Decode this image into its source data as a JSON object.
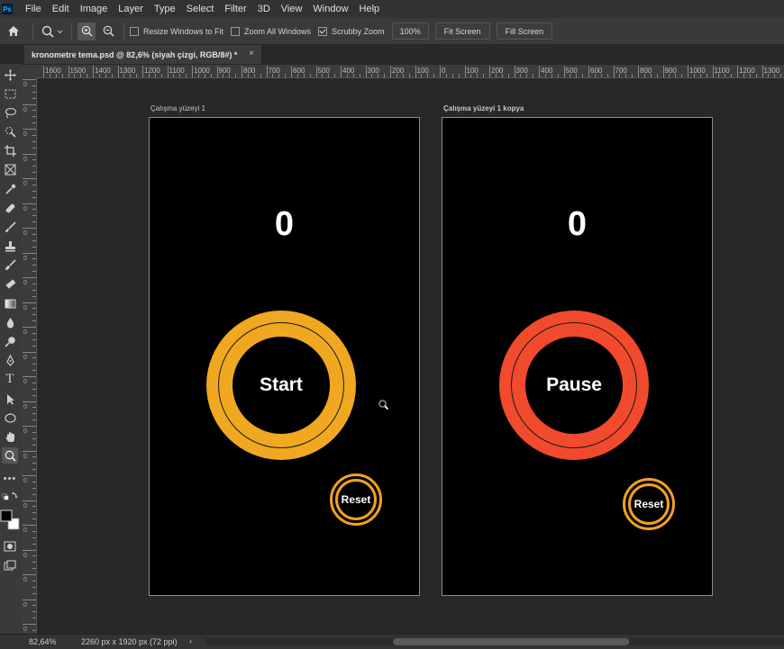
{
  "app": {
    "logo": "Ps"
  },
  "menu": [
    "File",
    "Edit",
    "Image",
    "Layer",
    "Type",
    "Select",
    "Filter",
    "3D",
    "View",
    "Window",
    "Help"
  ],
  "options_bar": {
    "resize_windows": "Resize Windows to Fit",
    "zoom_all": "Zoom All Windows",
    "scrubby_zoom": "Scrubby Zoom",
    "zoom_value": "100%",
    "fit_screen": "Fit Screen",
    "fill_screen": "Fill Screen"
  },
  "document_tab": {
    "title": "kronometre tema.psd @ 82,6% (siyah çizgi, RGB/8#) *",
    "close": "×"
  },
  "ruler_top": [
    "1600",
    "1500",
    "1400",
    "1300",
    "1200",
    "1100",
    "1000",
    "900",
    "800",
    "700",
    "600",
    "500",
    "400",
    "300",
    "200",
    "100",
    "0",
    "100",
    "200",
    "300",
    "400",
    "500",
    "600",
    "700",
    "800",
    "900",
    "1000",
    "1100",
    "1200",
    "1300"
  ],
  "ruler_left": [
    "0",
    "0",
    "0",
    "0",
    "0",
    "0",
    "0",
    "0",
    "0",
    "0",
    "0",
    "0",
    "0",
    "0",
    "0",
    "0",
    "0",
    "0",
    "0",
    "0",
    "0",
    "0",
    "0"
  ],
  "artboards": [
    {
      "label": "Çalışma yüzeyi 1",
      "counter": "0",
      "main_button": "Start",
      "main_color": "#f0a820",
      "reset": "Reset"
    },
    {
      "label": "Çalışma yüzeyi 1 kopya",
      "counter": "0",
      "main_button": "Pause",
      "main_color": "#f24a2c",
      "reset": "Reset"
    }
  ],
  "status": {
    "zoom": "82,64%",
    "doc_size": "2260 px x 1920 px (72 ppi)",
    "arrow": "›"
  }
}
